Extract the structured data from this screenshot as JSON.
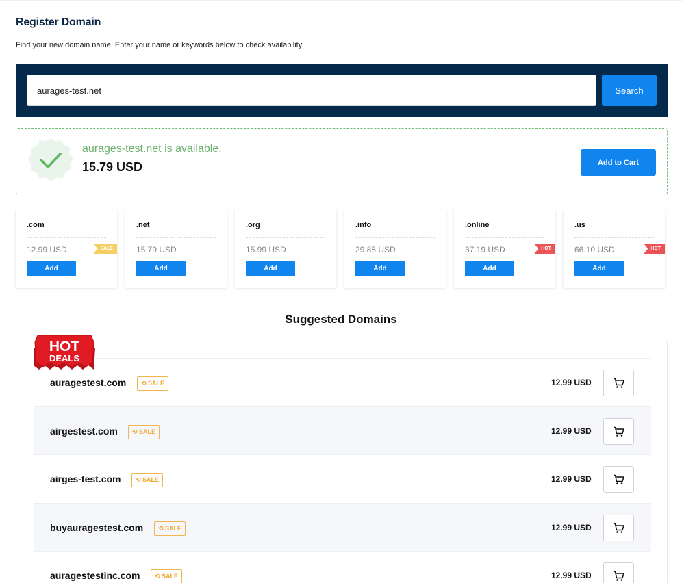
{
  "page": {
    "title": "Register Domain",
    "subtitle": "Find your new domain name. Enter your name or keywords below to check availability."
  },
  "search": {
    "value": "aurages-test.net",
    "button_label": "Search"
  },
  "availability": {
    "message": "aurages-test.net is available.",
    "price": "15.79 USD",
    "add_to_cart_label": "Add to Cart",
    "status_color": "#6cb26f",
    "icon": "checkmark-badge-icon"
  },
  "tlds": [
    {
      "name": ".com",
      "price": "12.99 USD",
      "add_label": "Add",
      "badge": "SALE"
    },
    {
      "name": ".net",
      "price": "15.79 USD",
      "add_label": "Add",
      "badge": ""
    },
    {
      "name": ".org",
      "price": "15.99 USD",
      "add_label": "Add",
      "badge": ""
    },
    {
      "name": ".info",
      "price": "29.88 USD",
      "add_label": "Add",
      "badge": ""
    },
    {
      "name": ".online",
      "price": "37.19 USD",
      "add_label": "Add",
      "badge": "HOT"
    },
    {
      "name": ".us",
      "price": "66.10 USD",
      "add_label": "Add",
      "badge": "HOT"
    }
  ],
  "suggestions": {
    "title": "Suggested Domains",
    "hot_deals_badge": {
      "line1": "HOT",
      "line2": "DEALS"
    },
    "rows": [
      {
        "name": "auragestest.com",
        "tag": "SALE",
        "price": "12.99 USD"
      },
      {
        "name": "airgestest.com",
        "tag": "SALE",
        "price": "12.99 USD"
      },
      {
        "name": "airges-test.com",
        "tag": "SALE",
        "price": "12.99 USD"
      },
      {
        "name": "buyauragestest.com",
        "tag": "SALE",
        "price": "12.99 USD"
      },
      {
        "name": "auragestestinc.com",
        "tag": "SALE",
        "price": "12.99 USD"
      }
    ]
  },
  "colors": {
    "accent": "#1185ee",
    "header_band": "#04294a",
    "sale": "#f0a933",
    "hot": "#ec5357"
  }
}
